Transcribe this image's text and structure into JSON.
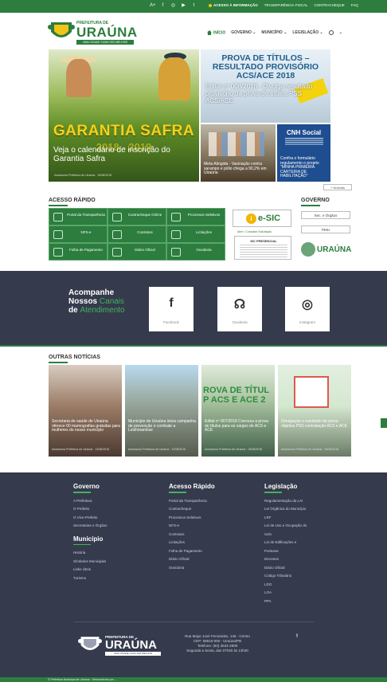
{
  "topbar": {
    "links": [
      "ACESSO À INFORMAÇÃO",
      "TRANSPARÊNCIA FISCAL",
      "CONTRACHEQUE",
      "FAQ"
    ]
  },
  "header": {
    "logo_prefix": "PREFEITURA DE",
    "logo_name": "URAÚNA",
    "logo_slogan": "UMA CIDADE CADA VEZ MELHOR",
    "nav": [
      "INÍCIO",
      "GOVERNO ⌄",
      "MUNICÍPIO ⌄",
      "LEGISLAÇÃO ⌄"
    ]
  },
  "hero": {
    "main": {
      "banner": "GARANTIA SAFRA",
      "years": "2018 - 2019",
      "caption": "Veja o calendário de inscrição do Garantia Safra",
      "meta": "Assessoria Prefeitura de Uiraúna · 15/08/2018"
    },
    "prova": {
      "headline": "PROVA DE TÍTULOS – RESULTADO PROVISÓRIO ACS/ACE 2018",
      "caption": "Edital nº 008/2018 - Divulga resultado provisório da prova de títulos PSS ACS/ACE"
    },
    "vacina": {
      "caption": "Meta Atingida - Vacinação contra sarampo e pólio chega a 90,2% em Uiraúna"
    },
    "cnh": {
      "title": "CNH Social",
      "caption": "Confira o formulário regulamento o projeto \"MINHA PRIMEIRA CARTEIRA DE HABILITAÇÃO\""
    },
    "more_link": "+ Notícias"
  },
  "acesso": {
    "title": "ACESSO RÁPIDO",
    "items": [
      "Portal da Transparência",
      "Contracheque Online",
      "Processos Seletivos",
      "NFS-e",
      "Contratos",
      "Licitações",
      "Folha de Pagamento",
      "Diário Oficial",
      "Ouvidoria"
    ]
  },
  "esic": {
    "label": "e-SIC",
    "sub": "Abrir / Consultar Solicitação",
    "presencial_title": "SIC PRESENCIAL"
  },
  "governo": {
    "title": "GOVERNO",
    "buttons": [
      "Sec. e Órgãos",
      "PMU"
    ],
    "logo_name": "URAÚNA"
  },
  "canais": {
    "line1": "Acompanhe",
    "line2a": "Nossos",
    "line2b": "Canais",
    "line3a": "de",
    "line3b": "Atendimento",
    "cards": [
      {
        "icon": "f",
        "label": "Facebook"
      },
      {
        "icon": "☊",
        "label": "Ouvidoria"
      },
      {
        "icon": "◎",
        "label": "Instagram"
      }
    ]
  },
  "outras": {
    "title": "OUTRAS NOTÍCIAS",
    "items": [
      {
        "caption": "Secretaria de saúde de Uiraúna oferece 60 mamografias gratuitas para mulheres do nosso município",
        "meta": "Assessoria Prefeitura de Uiraúna · 13/08/2018"
      },
      {
        "caption": "Município de Uiraúna inicia campanha de prevenção e combate a Leishmaniose",
        "meta": "Assessoria Prefeitura de Uiraúna · 13/08/2018"
      },
      {
        "caption": "Edital nº 007/2018 Convoca a prova de títulos para os cargos de ACS e ACE",
        "meta": "Assessoria Prefeitura de Uiraúna · 09/08/2018",
        "overlay": "ROVA DE TÍTUL P ACS E ACE 2"
      },
      {
        "caption": "Divulgação o resultado da prova objetiva PSS contratação ACS e ACE",
        "meta": "Assessoria Prefeitura de Uiraúna · 09/08/2018"
      }
    ]
  },
  "footer": {
    "governo": {
      "title": "Governo",
      "items": [
        "A Prefeitura",
        "O Prefeito",
        "O Vice-Prefeito",
        "Secretarias e Órgãos"
      ]
    },
    "municipio": {
      "title": "Município",
      "items": [
        "História",
        "Símbolos Municipais",
        "Links Úteis",
        "Turismo"
      ]
    },
    "acesso": {
      "title": "Acesso Rápido",
      "items": [
        "Portal da Transparência",
        "Contracheque",
        "Processos Seletivos",
        "NFS-e",
        "Contratos",
        "Licitações",
        "Folha de Pagamento",
        "Diário Oficial",
        "Ouvidoria"
      ]
    },
    "legislacao": {
      "title": "Legislação",
      "items": [
        "Regulamentação da LAI",
        "Lei Orgânica do Município",
        "LRF",
        "Lei de Uso e Ocupação do",
        "Solo",
        "Lei de Edificações e",
        "Posturas",
        "Decretos",
        "Diário Oficial",
        "Código Tributário",
        "LDO",
        "LOA",
        "PPA"
      ]
    },
    "logo_prefix": "PREFEITURA DE",
    "logo_name": "URAÚNA",
    "logo_slogan": "UMA CIDADE CADA VEZ MELHOR",
    "address": [
      "Rua Major José Fernandes, 146 - Centro",
      "CEP: 58915-000 - Uiraúna/PB",
      "Telefone: (83) 3534-2808",
      "Segunda a Sexta, das 07h30 às 13h30"
    ],
    "bottom": "© Prefeitura Municipal de Uiraúna · Desenvolvido por ..."
  }
}
